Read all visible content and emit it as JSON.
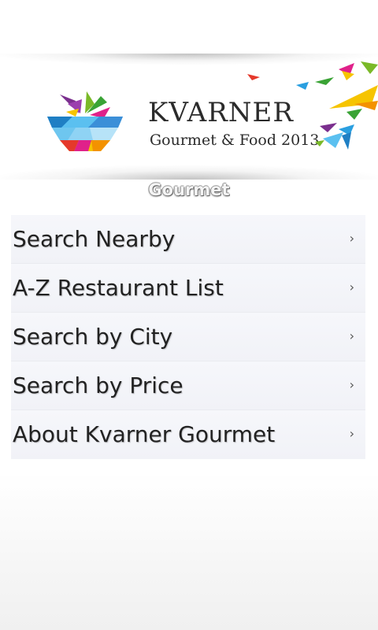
{
  "header": {
    "brand_title": "KVARNER",
    "brand_subtitle": "Gourmet & Food 2013"
  },
  "section": {
    "title": "Gourmet"
  },
  "menu": {
    "items": [
      {
        "label": "Search Nearby",
        "icon": "chevron-right-icon"
      },
      {
        "label": "A-Z Restaurant List",
        "icon": "chevron-right-icon"
      },
      {
        "label": "Search by City",
        "icon": "chevron-right-icon"
      },
      {
        "label": "Search by Price",
        "icon": "chevron-right-icon"
      },
      {
        "label": "About Kvarner Gourmet",
        "icon": "chevron-right-icon"
      }
    ],
    "chevron_glyph": "›"
  },
  "colors": {
    "menu_background": "#f5f6fa",
    "menu_text": "#222222",
    "logo_accents": [
      "#e0218a",
      "#7ab928",
      "#2a9fe0",
      "#f6c400",
      "#e5392b",
      "#7b2f8e"
    ]
  }
}
